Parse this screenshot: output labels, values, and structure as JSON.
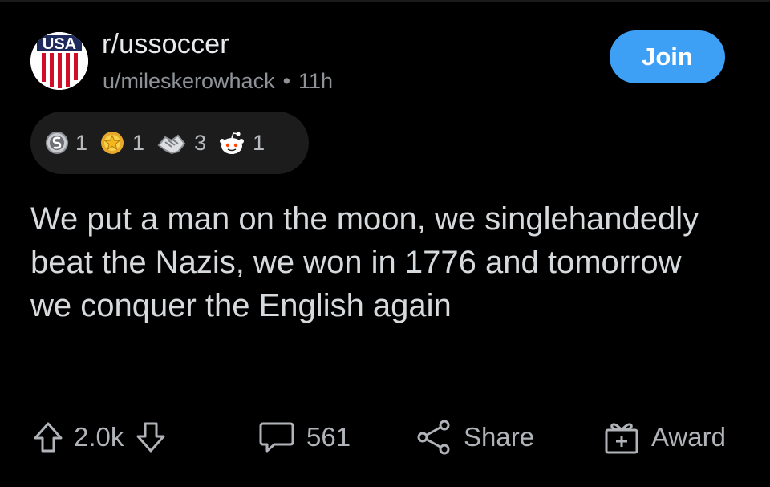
{
  "post": {
    "subreddit": "r/ussoccer",
    "author": "u/mileskerowhack",
    "separator": "•",
    "age": "11h",
    "join_label": "Join",
    "title": "We put a man on the moon, we singlehandedly beat the Nazis, we won in 1776 and tomorrow we conquer the English again"
  },
  "awards": [
    {
      "icon": "silver-award-icon",
      "count": "1"
    },
    {
      "icon": "gold-star-award-icon",
      "count": "1"
    },
    {
      "icon": "handshake-award-icon",
      "count": "3"
    },
    {
      "icon": "snoo-award-icon",
      "count": "1"
    }
  ],
  "actions": {
    "score": "2.0k",
    "comments": "561",
    "share_label": "Share",
    "award_label": "Award"
  },
  "colors": {
    "background": "#000000",
    "join_button": "#3da0f5",
    "text": "#d7dadc",
    "muted": "#8e9297"
  }
}
